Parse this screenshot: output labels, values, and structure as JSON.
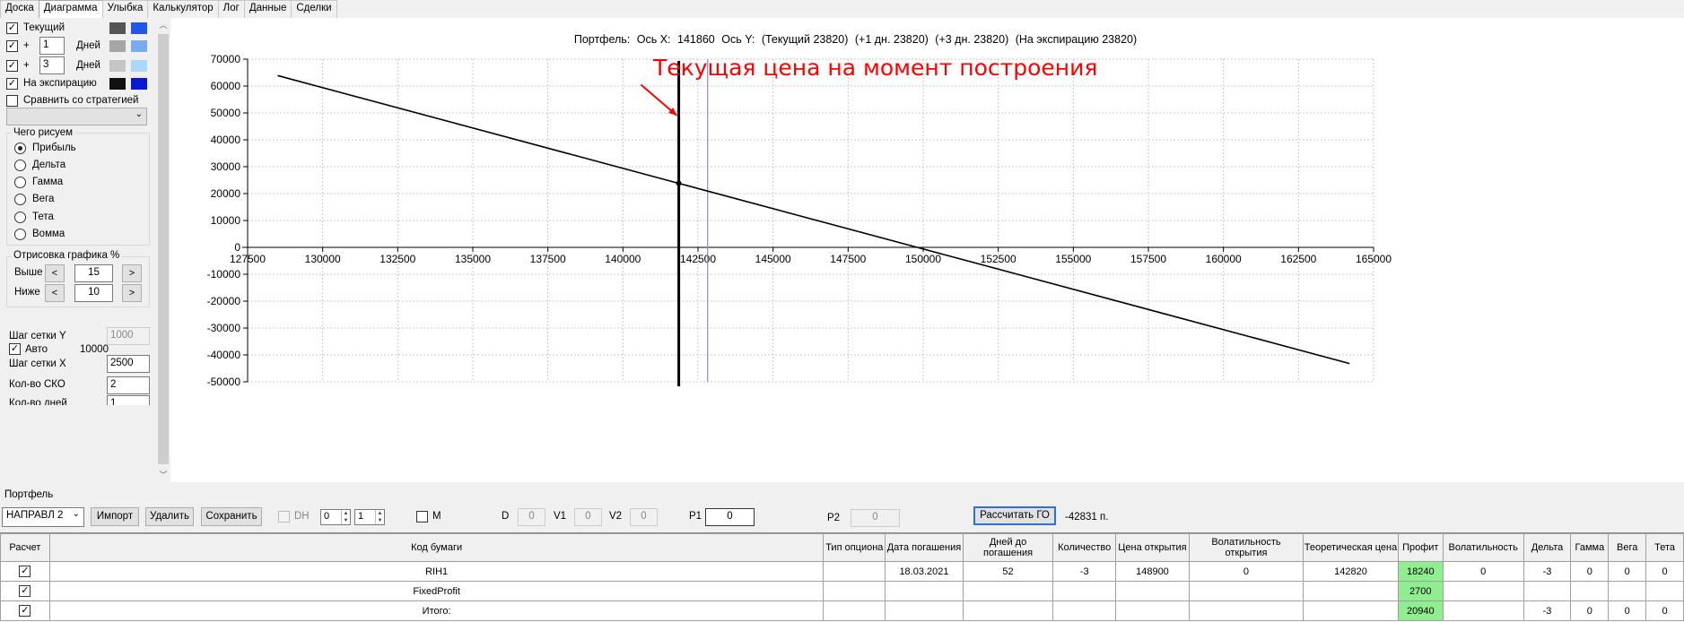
{
  "tabs": [
    "Доска",
    "Диаграмма",
    "Улыбка",
    "Калькулятор",
    "Лог",
    "Данные",
    "Сделки"
  ],
  "active_tab": 1,
  "left_panel": {
    "series_rows": [
      {
        "checked": true,
        "label": "Текущий",
        "swatch_1": "#555555",
        "swatch_2": "#2255e8"
      },
      {
        "checked": true,
        "prefix": "+",
        "days_value": "1",
        "suffix": "Дней",
        "swatch_1": "#a5a5a5",
        "swatch_2": "#7aaaf0"
      },
      {
        "checked": true,
        "prefix": "+",
        "days_value": "3",
        "suffix": "Дней",
        "swatch_1": "#c5c5c5",
        "swatch_2": "#aad8f8"
      },
      {
        "checked": true,
        "label": "На экспирацию",
        "swatch_1": "#111111",
        "swatch_2": "#0a1ad0"
      }
    ],
    "compare_label": "Сравнить со стратегией",
    "compare_checked": false,
    "what_to_draw": {
      "title": "Чего рисуем",
      "options": [
        "Прибыль",
        "Дельта",
        "Гамма",
        "Вега",
        "Тета",
        "Вомма"
      ],
      "selected": 0
    },
    "draw_percent": {
      "title": "Отрисовка графика %",
      "above_label": "Выше",
      "above_value": "15",
      "below_label": "Ниже",
      "below_value": "10",
      "dec": "<",
      "inc": ">"
    },
    "grid_y_label": "Шаг сетки Y",
    "grid_y_value": "1000",
    "auto_label": "Авто",
    "auto_checked": true,
    "auto_value": "10000",
    "grid_x_label": "Шаг сетки X",
    "grid_x_value": "2500",
    "sko_label": "Кол-во СКО",
    "sko_value": "2",
    "days_label": "Кол-во дней",
    "days_value": "1"
  },
  "chart_header": {
    "portfolio": "Портфель:",
    "axis_x": "Ось X:",
    "axis_x_value": "141860",
    "axis_y": "Ось Y:",
    "current": "(Текущий 23820)",
    "plus1": "(+1 дн. 23820)",
    "plus3": "(+3 дн. 23820)",
    "expiry": "(На экспирацию 23820)"
  },
  "chart_data": {
    "type": "line",
    "xlim": [
      127500,
      165000
    ],
    "ylim": [
      -50000,
      70000
    ],
    "x_ticks": [
      127500,
      130000,
      132500,
      135000,
      137500,
      140000,
      142500,
      145000,
      147500,
      150000,
      152500,
      155000,
      157500,
      160000,
      162500,
      165000
    ],
    "y_ticks": [
      70000,
      60000,
      50000,
      40000,
      30000,
      20000,
      10000,
      0,
      -10000,
      -20000,
      -30000,
      -40000,
      -50000
    ],
    "x_tick_labels": [
      "127500",
      "130000",
      "132500",
      "135000",
      "137500",
      "140000",
      "142500",
      "145000",
      "147500",
      "150000",
      "152500",
      "155000",
      "157500",
      "160000",
      "162500",
      "165000"
    ],
    "y_tick_labels": [
      "70000",
      "60000",
      "50000",
      "40000",
      "30000",
      "20000",
      "10000",
      "0",
      "-10000",
      "-20000",
      "-30000",
      "-40000",
      "-50000"
    ],
    "grid": true,
    "series": [
      {
        "color": "#000000",
        "points": [
          [
            128500,
            63900
          ],
          [
            164200,
            -43200
          ]
        ]
      }
    ],
    "marker_point": [
      141860,
      23820
    ],
    "vertical_lines": [
      {
        "x": 141860,
        "color": "#000000",
        "weight": "bold"
      },
      {
        "x": 142820,
        "color": "#8c8cc8",
        "weight": "thin"
      }
    ],
    "annotation": {
      "text": "Текущая цена на момент построения",
      "color": "#ff0000",
      "arrow_from": [
        140600,
        60500
      ],
      "arrow_to": [
        141800,
        49000
      ]
    }
  },
  "portfolio": {
    "label": "Портфель",
    "selected": "НАПРАВЛ 2",
    "import_label": "Импорт",
    "delete_label": "Удалить",
    "save_label": "Сохранить",
    "dh_label": "DH",
    "dh_spin1": "0",
    "dh_spin2": "1",
    "m_label": "M",
    "d_label": "D",
    "d_value": "0",
    "v1_label": "V1",
    "v1_value": "0",
    "v2_label": "V2",
    "v2_value": "0",
    "p1_label": "P1",
    "p1_value": "0",
    "p2_label": "P2",
    "p2_value": "0",
    "calc_go_label": "Рассчитать ГО",
    "go_result": "-42831 п."
  },
  "table": {
    "columns": [
      "Расчет",
      "Код бумаги",
      "Тип опциона",
      "Дата погашения",
      "Дней до погашения",
      "Количество",
      "Цена открытия",
      "Волатильность открытия",
      "Теоретическая цена",
      "Профит",
      "Волатильность",
      "Дельта",
      "Гамма",
      "Вега",
      "Тета"
    ],
    "rows": [
      {
        "calc": true,
        "code": "RIH1",
        "type": "",
        "date": "18.03.2021",
        "days": "52",
        "qty": "-3",
        "open_price": "148900",
        "open_vol": "0",
        "theor": "142820",
        "profit": "18240",
        "vol": "0",
        "delta": "-3",
        "gamma": "0",
        "vega": "0",
        "theta": "0"
      },
      {
        "calc": true,
        "code": "FixedProfit",
        "type": "",
        "date": "",
        "days": "",
        "qty": "",
        "open_price": "",
        "open_vol": "",
        "theor": "",
        "profit": "2700",
        "vol": "",
        "delta": "",
        "gamma": "",
        "vega": "",
        "theta": ""
      },
      {
        "calc": true,
        "code": "Итого:",
        "type": "",
        "date": "",
        "days": "",
        "qty": "",
        "open_price": "",
        "open_vol": "",
        "theor": "",
        "profit": "20940",
        "vol": "",
        "delta": "-3",
        "gamma": "0",
        "vega": "0",
        "theta": "0"
      }
    ]
  }
}
